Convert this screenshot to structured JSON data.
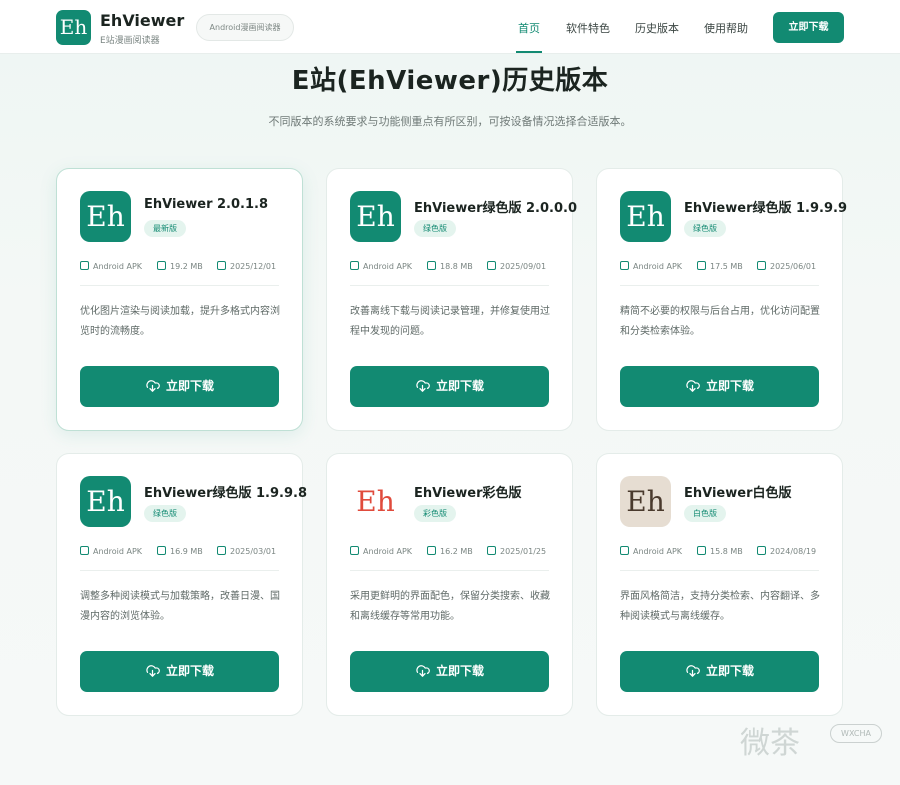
{
  "header": {
    "logo_text": "Eh",
    "brand_name": "EhViewer",
    "brand_sub": "E站漫画阅读器",
    "pill": "Android漫画阅读器",
    "nav": [
      "首页",
      "软件特色",
      "历史版本",
      "使用帮助"
    ],
    "download": "立即下载"
  },
  "hero": {
    "title": "E站(EhViewer)历史版本",
    "subtitle": "不同版本的系统要求与功能侧重点有所区别，可按设备情况选择合适版本。"
  },
  "cards": [
    {
      "icon_text": "Eh",
      "icon_style": "green",
      "title": "EhViewer 2.0.1.8",
      "badge": "最新版",
      "platform": "Android APK",
      "size": "19.2 MB",
      "date": "2025/12/01",
      "desc": "优化图片渲染与阅读加载，提升多格式内容浏览时的流畅度。",
      "button": "立即下载"
    },
    {
      "icon_text": "Eh",
      "icon_style": "green",
      "title": "EhViewer绿色版 2.0.0.0",
      "badge": "绿色版",
      "platform": "Android APK",
      "size": "18.8 MB",
      "date": "2025/09/01",
      "desc": "改善离线下载与阅读记录管理，并修复使用过程中发现的问题。",
      "button": "立即下载"
    },
    {
      "icon_text": "Eh",
      "icon_style": "green",
      "title": "EhViewer绿色版 1.9.9.9",
      "badge": "绿色版",
      "platform": "Android APK",
      "size": "17.5 MB",
      "date": "2025/06/01",
      "desc": "精简不必要的权限与后台占用，优化访问配置和分类检索体验。",
      "button": "立即下载"
    },
    {
      "icon_text": "Eh",
      "icon_style": "green",
      "title": "EhViewer绿色版 1.9.9.8",
      "badge": "绿色版",
      "platform": "Android APK",
      "size": "16.9 MB",
      "date": "2025/03/01",
      "desc": "调整多种阅读模式与加载策略，改善日漫、国漫内容的浏览体验。",
      "button": "立即下载"
    },
    {
      "icon_text": "Eh",
      "icon_style": "colorful",
      "title": "EhViewer彩色版",
      "badge": "彩色版",
      "platform": "Android APK",
      "size": "16.2 MB",
      "date": "2025/01/25",
      "desc": "采用更鲜明的界面配色，保留分类搜索、收藏和离线缓存等常用功能。",
      "button": "立即下载"
    },
    {
      "icon_text": "Eh",
      "icon_style": "white",
      "title": "EhViewer白色版",
      "badge": "白色版",
      "platform": "Android APK",
      "size": "15.8 MB",
      "date": "2024/08/19",
      "desc": "界面风格简洁，支持分类检索、内容翻译、多种阅读模式与离线缓存。",
      "button": "立即下载"
    }
  ],
  "watermark": {
    "text": "微茶",
    "tag": "WXCHA"
  },
  "colors": {
    "accent": "#128a72",
    "badge_bg": "#e4f4ee",
    "white_icon_bg": "#e6ddd2"
  }
}
